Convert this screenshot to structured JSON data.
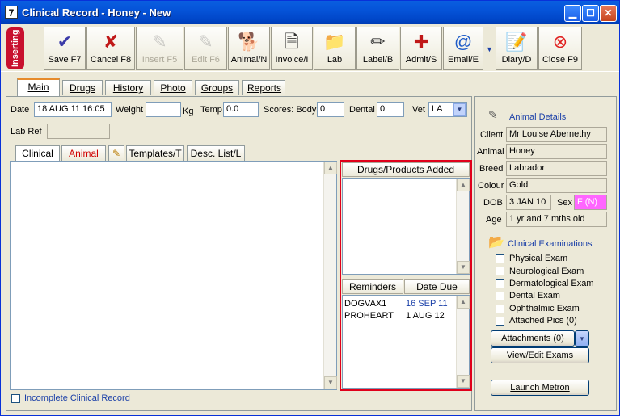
{
  "window": {
    "title": "Clinical Record - Honey - New",
    "app_icon_glyph": "7"
  },
  "toolbar": {
    "status_badge": "Inserting",
    "buttons": [
      {
        "label": "Save F7",
        "icon": "check-icon",
        "glyph": "✔",
        "color": "#3b3ba8",
        "enabled": true
      },
      {
        "label": "Cancel F8",
        "icon": "cross-icon",
        "glyph": "✘",
        "color": "#c01818",
        "enabled": true
      },
      {
        "label": "Insert F5",
        "icon": "insert-doc-icon",
        "glyph": "✎",
        "color": "#888888",
        "enabled": false
      },
      {
        "label": "Edit F6",
        "icon": "edit-doc-icon",
        "glyph": "✎",
        "color": "#888888",
        "enabled": false
      },
      {
        "label": "Animal/N",
        "icon": "dog-icon",
        "glyph": "🐕",
        "color": "#333333",
        "enabled": true
      },
      {
        "label": "Invoice/I",
        "icon": "invoice-icon",
        "glyph": "🗎",
        "color": "#333333",
        "enabled": true
      },
      {
        "label": "Lab",
        "icon": "folder-icon",
        "glyph": "📁",
        "color": "#d9a400",
        "enabled": true
      },
      {
        "label": "Label/B",
        "icon": "label-icon",
        "glyph": "✏",
        "color": "#333333",
        "enabled": true
      },
      {
        "label": "Admit/S",
        "icon": "admit-dog-icon",
        "glyph": "✚",
        "color": "#c01818",
        "enabled": true
      },
      {
        "label": "Email/E",
        "icon": "email-icon",
        "glyph": "@",
        "color": "#1f5cc8",
        "enabled": true
      },
      {
        "label": "Diary/D",
        "icon": "diary-icon",
        "glyph": "📝",
        "color": "#333333",
        "enabled": true
      },
      {
        "label": "Close F9",
        "icon": "close-circle-icon",
        "glyph": "⊗",
        "color": "#e02020",
        "enabled": true
      }
    ]
  },
  "main_tabs": [
    "Main",
    "Drugs",
    "History",
    "Photo",
    "Groups",
    "Reports"
  ],
  "visit": {
    "date_label": "Date",
    "date_value": "18 AUG 11  16:05",
    "weight_label": "Weight",
    "weight_value": "",
    "weight_unit": "Kg",
    "temp_label": "Temp",
    "temp_value": "0.0",
    "scores_body_label": "Scores: Body",
    "scores_body_value": "0",
    "dental_label": "Dental",
    "dental_value": "0",
    "vet_label": "Vet",
    "vet_value": "LA",
    "lab_ref_label": "Lab Ref",
    "lab_ref_value": ""
  },
  "sub_tabs": {
    "clinical": "Clinical",
    "animal": "Animal",
    "templates": "Templates/T",
    "desc_list": "Desc. List/L"
  },
  "drugs_panel": {
    "header": "Drugs/Products Added"
  },
  "reminders": {
    "col_name": "Reminders",
    "col_date": "Date Due",
    "rows": [
      {
        "name": "DOGVAX1",
        "due": "16 SEP 11",
        "overdue": false,
        "highlight": true
      },
      {
        "name": "PROHEART",
        "due": "1 AUG 12",
        "overdue": true,
        "highlight": false
      }
    ]
  },
  "incomplete_label": "Incomplete Clinical Record",
  "animal_details": {
    "heading": "Animal Details",
    "client_label": "Client",
    "client": "Mr Louise Abernethy",
    "animal_label": "Animal",
    "animal": "Honey",
    "breed_label": "Breed",
    "breed": "Labrador",
    "colour_label": "Colour",
    "colour": "Gold",
    "dob_label": "DOB",
    "dob": "3 JAN 10",
    "sex_label": "Sex",
    "sex": "F (N)",
    "age_label": "Age",
    "age": "1 yr and 7 mths old"
  },
  "clinical_exams": {
    "heading": "Clinical Examinations",
    "items": [
      "Physical Exam",
      "Neurological Exam",
      "Dermatological Exam",
      "Dental Exam",
      "Ophthalmic Exam",
      "Attached Pics (0)"
    ]
  },
  "buttons": {
    "attachments": "Attachments (0)",
    "view_edit_exams": "View/Edit Exams",
    "launch_metron": "Launch Metron"
  },
  "colors": {
    "accent_red_box": "#e0001b",
    "sex_highlight": "#ff66ff",
    "link_blue": "#1a3fa8"
  }
}
